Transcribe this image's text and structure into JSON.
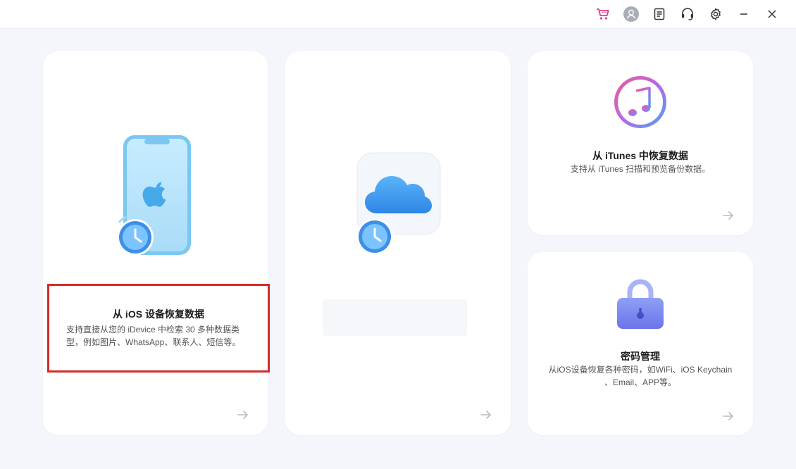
{
  "titlebar": {
    "icons": [
      "cart-icon",
      "user-icon",
      "document-icon",
      "headset-icon",
      "settings-icon",
      "minimize-icon",
      "close-icon"
    ]
  },
  "cards": {
    "ios": {
      "title": "从 iOS 设备恢复数据",
      "desc": "支持直接从您的 iDevice 中检索 30 多种数据类型，例如图片、WhatsApp、联系人、短信等。"
    },
    "itunes": {
      "title": "从 iTunes 中恢复数据",
      "desc": "支持从 iTunes 扫描和预览备份数据。"
    },
    "password": {
      "title": "密码管理",
      "desc_line1": "从iOS设备恢复各种密码，如WiFi、iOS Keychain",
      "desc_line2": "、Email、APP等。"
    }
  },
  "colors": {
    "background": "#f4f6fb",
    "card": "#ffffff",
    "highlight_border": "#d42a2a",
    "phone_blue": "#7ac8f2",
    "accent_blue": "#3d8fe8",
    "lock_purple": "#7d88f0"
  }
}
